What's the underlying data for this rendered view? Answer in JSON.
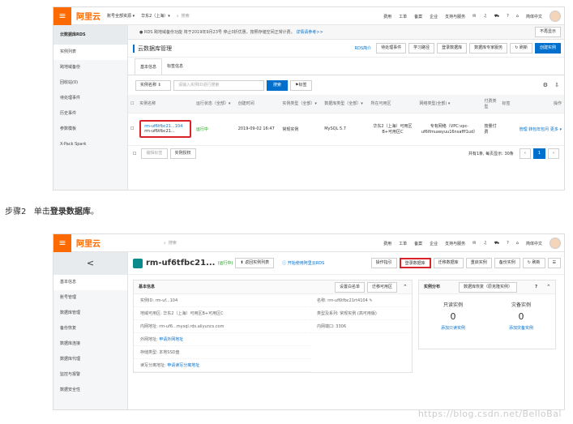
{
  "s1": {
    "logo": "阿里云",
    "region": "账号全部资源 ▾",
    "zone": "华东2（上海）▾",
    "search_ph": "搜索",
    "topnav": [
      "费用",
      "工单",
      "备案",
      "企业",
      "支持与服务",
      "简体中文"
    ],
    "side_title": "云数据库RDS",
    "side_items": [
      "实例列表",
      "跨地域备份",
      "回收站(0)",
      "待处理事件",
      "历史事件",
      "参数模板",
      "X-Pack Spark"
    ],
    "notice": "RDS 跨地域备份功能 将于2019年9月23号 停止0折优惠，按照存储空间正常计费。",
    "notice_link": "详情请参考>>",
    "notice_btn": "不再显示",
    "page_title": "云数据库管理",
    "rds_intro": "RDS简介",
    "head_btns": [
      "待处理事件",
      "学习路径",
      "登录数据库",
      "数据库专家服务"
    ],
    "refresh": "刷新",
    "create": "创建实例",
    "tabs": [
      "基本信息",
      "标签信息"
    ],
    "filter_sel": "实例名称",
    "filter_ph": "请输入实例ID进行搜索",
    "search_btn": "搜索",
    "tag_btn": "标签",
    "cols": [
      "实例名称",
      "运行状态（全部）▾",
      "创建时间",
      "实例类型（全部）▾",
      "数据库类型（全部）▾",
      "所在可用区",
      "网络类型(全部) ▾",
      "付费类型",
      "标签",
      "操作"
    ],
    "inst_id": "rm-uf6tfbc21...104",
    "inst_sub": "rm-uf6tfbc21...",
    "status": "运行中",
    "created": "2019-09-02 16:47",
    "inst_type": "常规实例",
    "db_type": "MySQL 5.7",
    "zone_cell": "华东2（上海）可用区B+可用区C",
    "net": "专有网络（VPC:vpc-uf6lfmuxeyuu16nsafff1ud）",
    "pay": "按量付费",
    "ops": [
      "管理",
      "转包年包月",
      "更多 ▾"
    ],
    "btn_edit_tag": "编辑标签",
    "btn_batch": "实例授权",
    "pager": "共有1条, 每页显示: 30条",
    "page": "1"
  },
  "step": {
    "label": "步骤2",
    "pre": "单击",
    "bold": "登录数据库",
    "end": "。"
  },
  "s2": {
    "logo": "阿里云",
    "search_ph": "搜索",
    "topnav": [
      "费用",
      "工单",
      "备案",
      "企业",
      "支持与服务",
      "简体中文"
    ],
    "back": "<",
    "side_items": [
      "基本信息",
      "账号管理",
      "数据库管理",
      "备份恢复",
      "数据库连接",
      "数据库代理",
      "监控与报警",
      "数据安全性"
    ],
    "inst_title": "rm-uf6tfbc21...",
    "status": "(运行中)",
    "back_btn": "返回实例列表",
    "guide": "开始使用阿里云RDS",
    "btns": [
      "操作指引",
      "登录数据库",
      "迁移数据库",
      "重启实例",
      "备份实例",
      "刷新"
    ],
    "basic_title": "基本信息",
    "set_wl": "设置白名单",
    "migrate_zone": "迁移可用区",
    "kv": [
      {
        "k": "实例ID:",
        "v": "rm-uf...104"
      },
      {
        "k": "地域可用区:",
        "v": "华东2（上海）可用区B+可用区C"
      },
      {
        "k": "内网地址:",
        "v": "rm-uf6...mysql.rds.aliyuncs.com"
      },
      {
        "k": "外网地址:",
        "v": "申请外网地址",
        "link": true
      },
      {
        "k": "存储类型:",
        "v": "本地SSD盘"
      },
      {
        "k": "读写分离地址:",
        "v": "申请读写分离地址",
        "link": true
      }
    ],
    "kv_right": [
      {
        "k": "名称:",
        "v": "rm-uf6tfbc21rt4104"
      },
      {
        "k": "类型及系列:",
        "v": "常规实例 (高可用版)"
      },
      {
        "k": "内网端口:",
        "v": "3306"
      }
    ],
    "dist_title": "实例分布",
    "dist_btn": "数据库恢复（原克隆实例）",
    "ro_label": "只读实例",
    "ro_val": "0",
    "ro_add": "添加只读实例",
    "bk_label": "灾备实例",
    "bk_val": "0",
    "bk_add": "添加灾备实例"
  },
  "watermark": "https://blog.csdn.net/BelloBal"
}
